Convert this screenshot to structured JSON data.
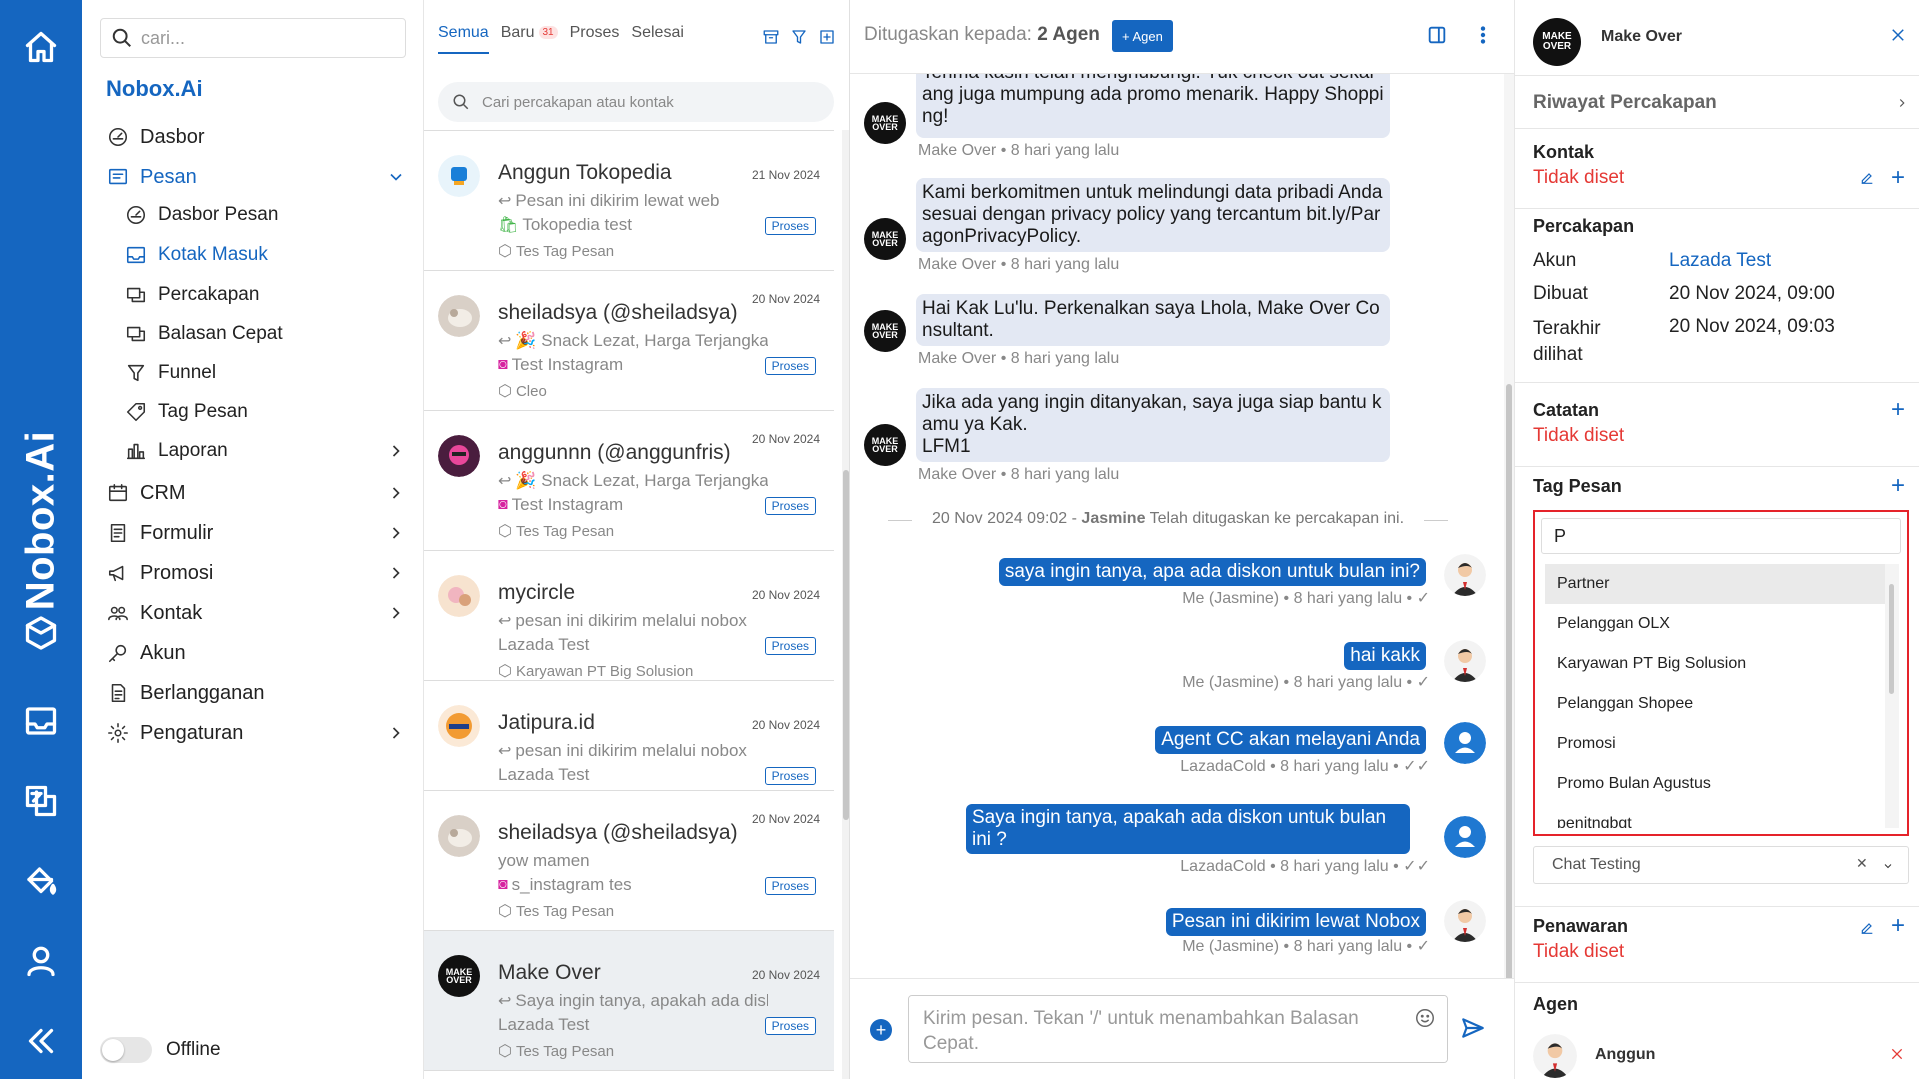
{
  "rail": {
    "brand": "Nobox.Ai",
    "icons": [
      "home-icon",
      "hexagon-logo-icon",
      "inbox-icon",
      "translate-icon",
      "paint-bucket-icon",
      "user-icon",
      "collapse-icon"
    ]
  },
  "nav": {
    "search_placeholder": "cari...",
    "brand": "Nobox.Ai",
    "items": [
      {
        "label": "Dasbor",
        "icon": "dashboard-icon"
      },
      {
        "label": "Pesan",
        "icon": "message-icon"
      },
      {
        "label": "Dasbor Pesan",
        "icon": "dashboard-icon"
      },
      {
        "label": "Kotak Masuk",
        "icon": "inbox-icon"
      },
      {
        "label": "Percakapan",
        "icon": "chat-icon"
      },
      {
        "label": "Balasan Cepat",
        "icon": "chat-icon"
      },
      {
        "label": "Funnel",
        "icon": "funnel-icon"
      },
      {
        "label": "Tag Pesan",
        "icon": "tag-icon"
      },
      {
        "label": "Laporan",
        "icon": "report-icon"
      },
      {
        "label": "CRM",
        "icon": "crm-icon"
      },
      {
        "label": "Formulir",
        "icon": "form-icon"
      },
      {
        "label": "Promosi",
        "icon": "megaphone-icon"
      },
      {
        "label": "Kontak",
        "icon": "contacts-icon"
      },
      {
        "label": "Akun",
        "icon": "key-icon"
      },
      {
        "label": "Berlangganan",
        "icon": "subscription-icon"
      },
      {
        "label": "Pengaturan",
        "icon": "gear-icon"
      }
    ],
    "status_label": "Offline"
  },
  "conversations": {
    "tabs": [
      {
        "label": "Semua"
      },
      {
        "label": "Baru",
        "badge": "31"
      },
      {
        "label": "Proses"
      },
      {
        "label": "Selesai"
      }
    ],
    "search_placeholder": "Cari percakapan atau kontak",
    "items": [
      {
        "name": "Anggun Tokopedia",
        "date": "21 Nov 2024",
        "preview": "Pesan ini dikirim lewat web",
        "account": "Tokopedia test",
        "tag": "Tes Tag Pesan",
        "status": "Proses",
        "channel": "tokopedia"
      },
      {
        "name": "sheiladsya (@sheiladsya)",
        "date": "20 Nov 2024",
        "preview": "🎉 Snack Lezat, Harga Terjangkau",
        "account": "Test Instagram",
        "tag": "Cleo",
        "status": "Proses",
        "channel": "instagram"
      },
      {
        "name": "anggunnn (@anggunfris)",
        "date": "20 Nov 2024",
        "preview": "🎉 Snack Lezat, Harga Terjangkau",
        "account": "Test Instagram",
        "tag": "Tes Tag Pesan",
        "status": "Proses",
        "channel": "instagram"
      },
      {
        "name": "mycircle",
        "date": "20 Nov 2024",
        "preview": "pesan ini dikirim melalui nobox",
        "account": "Lazada Test",
        "tag": "Karyawan PT Big Solusion",
        "status": "Proses",
        "channel": "lazada"
      },
      {
        "name": "Jatipura.id",
        "date": "20 Nov 2024",
        "preview": "pesan ini dikirim melalui nobox",
        "account": "Lazada Test",
        "tag": "",
        "status": "Proses",
        "channel": "lazada"
      },
      {
        "name": "sheiladsya (@sheiladsya)",
        "date": "20 Nov 2024",
        "preview": "yow mamen",
        "account": "s_instagram tes",
        "tag": "Tes Tag Pesan",
        "status": "Proses",
        "channel": "instagram"
      },
      {
        "name": "Make Over",
        "date": "20 Nov 2024",
        "preview": "Saya ingin tanya, apakah ada diskon",
        "account": "Lazada Test",
        "tag": "Tes Tag Pesan",
        "status": "Proses",
        "channel": "lazada"
      }
    ]
  },
  "chat": {
    "assigned_prefix": "Ditugaskan kepada:",
    "assigned_count": "2 Agen",
    "add_agent": "+ Agen",
    "incoming": [
      {
        "text": "Terima kasih telah menghubungi. Yuk check out sekarang juga mumpung ada promo menarik. Happy Shopping!",
        "meta": "Make Over • 8 hari yang lalu"
      },
      {
        "text": "Kami berkomitmen untuk melindungi data pribadi Anda sesuai dengan privacy policy yang tercantum bit.ly/ParagonPrivacyPolicy.",
        "meta": "Make Over • 8 hari yang lalu"
      },
      {
        "text": "Hai Kak Lu'lu. Perkenalkan saya Lhola, Make Over Consultant.",
        "meta": "Make Over • 8 hari yang lalu"
      },
      {
        "text": "Jika ada yang ingin ditanyakan, saya juga siap bantu kamu ya Kak.\nLFM1",
        "meta": "Make Over • 8 hari yang lalu"
      }
    ],
    "system": {
      "time": "20 Nov 2024 09:02 - ",
      "who": "Jasmine",
      "text": " Telah ditugaskan ke percakapan ini."
    },
    "outgoing": [
      {
        "text": "saya ingin tanya, apa ada diskon untuk bulan ini?",
        "meta": "Me (Jasmine) • 8 hari yang lalu • ✓"
      },
      {
        "text": "hai kakk",
        "meta": "Me (Jasmine) • 8 hari yang lalu • ✓"
      },
      {
        "text": "Agent CC akan melayani Anda",
        "meta": "LazadaCold • 8 hari yang lalu • ✓✓"
      },
      {
        "text": "Saya ingin tanya, apakah ada diskon untuk bulan ini ?",
        "meta": "LazadaCold • 8 hari yang lalu • ✓✓"
      },
      {
        "text": "Pesan ini dikirim lewat Nobox",
        "meta": "Me (Jasmine) • 8 hari yang lalu • ✓"
      }
    ],
    "composer_placeholder": "Kirim pesan. Tekan '/' untuk menambahkan Balasan Cepat."
  },
  "contact_panel": {
    "name": "Make Over",
    "history_label": "Riwayat Percakapan",
    "kontak_title": "Kontak",
    "not_set": "Tidak diset",
    "percakapan_title": "Percakapan",
    "akun_label": "Akun",
    "akun_value": "Lazada Test",
    "dibuat_label": "Dibuat",
    "dibuat_value": "20 Nov 2024, 09:00",
    "terakhir_label": "Terakhir dilihat",
    "terakhir_value": "20 Nov 2024, 09:03",
    "catatan_title": "Catatan",
    "tag_title": "Tag Pesan",
    "tag_search_value": "P",
    "tag_options": [
      "Partner",
      "Pelanggan OLX",
      "Karyawan PT Big Solusion",
      "Pelanggan Shopee",
      "Promosi",
      "Promo Bulan Agustus",
      "penitngbgt"
    ],
    "selected_tag": "Chat Testing",
    "penawaran_title": "Penawaran",
    "agen_title": "Agen",
    "agent_name": "Anggun",
    "colors": {
      "accent": "#1566c0",
      "danger": "#e53935",
      "highlight_border": "#e5232a"
    }
  }
}
